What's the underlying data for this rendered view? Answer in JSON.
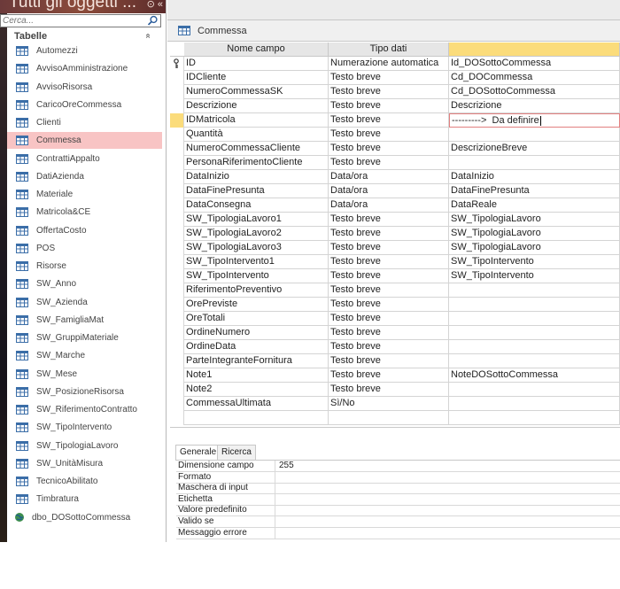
{
  "nav": {
    "title": "Tutti gli oggetti ...",
    "header_icons": "⊙ «",
    "search_placeholder": "Cerca...",
    "group_label": "Tabelle",
    "group_chevron": "«",
    "items": [
      {
        "label": "Automezzi",
        "type": "table",
        "selected": false
      },
      {
        "label": "AvvisoAmministrazione",
        "type": "table",
        "selected": false
      },
      {
        "label": "AvvisoRisorsa",
        "type": "table",
        "selected": false
      },
      {
        "label": "CaricoOreCommessa",
        "type": "table",
        "selected": false
      },
      {
        "label": "Clienti",
        "type": "table",
        "selected": false
      },
      {
        "label": "Commessa",
        "type": "table",
        "selected": true
      },
      {
        "label": "ContrattiAppalto",
        "type": "table",
        "selected": false
      },
      {
        "label": "DatiAzienda",
        "type": "table",
        "selected": false
      },
      {
        "label": "Materiale",
        "type": "table",
        "selected": false
      },
      {
        "label": "Matricola&CE",
        "type": "table",
        "selected": false
      },
      {
        "label": "OffertaCosto",
        "type": "table",
        "selected": false
      },
      {
        "label": "POS",
        "type": "table",
        "selected": false
      },
      {
        "label": "Risorse",
        "type": "table",
        "selected": false
      },
      {
        "label": "SW_Anno",
        "type": "table",
        "selected": false
      },
      {
        "label": "SW_Azienda",
        "type": "table",
        "selected": false
      },
      {
        "label": "SW_FamigliaMat",
        "type": "table",
        "selected": false
      },
      {
        "label": "SW_GruppiMateriale",
        "type": "table",
        "selected": false
      },
      {
        "label": "SW_Marche",
        "type": "table",
        "selected": false
      },
      {
        "label": "SW_Mese",
        "type": "table",
        "selected": false
      },
      {
        "label": "SW_PosizioneRisorsa",
        "type": "table",
        "selected": false
      },
      {
        "label": "SW_RiferimentoContratto",
        "type": "table",
        "selected": false
      },
      {
        "label": "SW_TipoIntervento",
        "type": "table",
        "selected": false
      },
      {
        "label": "SW_TipologiaLavoro",
        "type": "table",
        "selected": false
      },
      {
        "label": "SW_UnitàMisura",
        "type": "table",
        "selected": false
      },
      {
        "label": "TecnicoAbilitato",
        "type": "table",
        "selected": false
      },
      {
        "label": "Timbratura",
        "type": "table",
        "selected": false
      },
      {
        "label": "dbo_DOSottoCommessa",
        "type": "linked",
        "selected": false
      }
    ]
  },
  "document": {
    "tab_title": "Commessa",
    "columns": [
      "Nome campo",
      "Tipo dati",
      ""
    ],
    "rows": [
      {
        "name": "ID",
        "type": "Numerazione automatica",
        "desc": "Id_DOSottoCommessa",
        "key": true
      },
      {
        "name": "IDCliente",
        "type": "Testo breve",
        "desc": "Cd_DOCommessa"
      },
      {
        "name": "NumeroCommessaSK",
        "type": "Testo breve",
        "desc": "Cd_DOSottoCommessa"
      },
      {
        "name": "Descrizione",
        "type": "Testo breve",
        "desc": "Descrizione"
      },
      {
        "name": "IDMatricola",
        "type": "Testo breve",
        "desc": "--------->  Da definire",
        "active": true
      },
      {
        "name": "Quantità",
        "type": "Testo breve",
        "desc": ""
      },
      {
        "name": "NumeroCommessaCliente",
        "type": "Testo breve",
        "desc": "DescrizioneBreve"
      },
      {
        "name": "PersonaRiferimentoCliente",
        "type": "Testo breve",
        "desc": ""
      },
      {
        "name": "DataInizio",
        "type": "Data/ora",
        "desc": "DataInizio"
      },
      {
        "name": "DataFinePresunta",
        "type": "Data/ora",
        "desc": "DataFinePresunta"
      },
      {
        "name": "DataConsegna",
        "type": "Data/ora",
        "desc": "DataReale"
      },
      {
        "name": "SW_TipologiaLavoro1",
        "type": "Testo breve",
        "desc": "SW_TipologiaLavoro"
      },
      {
        "name": "SW_TipologiaLavoro2",
        "type": "Testo breve",
        "desc": "SW_TipologiaLavoro"
      },
      {
        "name": "SW_TipologiaLavoro3",
        "type": "Testo breve",
        "desc": "SW_TipologiaLavoro"
      },
      {
        "name": "SW_TipoIntervento1",
        "type": "Testo breve",
        "desc": "SW_TipoIntervento"
      },
      {
        "name": "SW_TipoIntervento",
        "type": "Testo breve",
        "desc": "SW_TipoIntervento"
      },
      {
        "name": "RiferimentoPreventivo",
        "type": "Testo breve",
        "desc": ""
      },
      {
        "name": "OrePreviste",
        "type": "Testo breve",
        "desc": ""
      },
      {
        "name": "OreTotali",
        "type": "Testo breve",
        "desc": ""
      },
      {
        "name": "OrdineNumero",
        "type": "Testo breve",
        "desc": ""
      },
      {
        "name": "OrdineData",
        "type": "Testo breve",
        "desc": ""
      },
      {
        "name": "ParteIntegranteFornitura",
        "type": "Testo breve",
        "desc": ""
      },
      {
        "name": "Note1",
        "type": "Testo breve",
        "desc": "NoteDOSottoCommessa"
      },
      {
        "name": "Note2",
        "type": "Testo breve",
        "desc": ""
      },
      {
        "name": "CommessaUltimata",
        "type": "Sì/No",
        "desc": ""
      },
      {
        "name": "",
        "type": "",
        "desc": ""
      }
    ]
  },
  "properties": {
    "tabs": [
      "Generale",
      "Ricerca"
    ],
    "active_tab": "Generale",
    "rows": [
      {
        "label": "Dimensione campo",
        "value": "255"
      },
      {
        "label": "Formato",
        "value": ""
      },
      {
        "label": "Maschera di input",
        "value": ""
      },
      {
        "label": "Etichetta",
        "value": ""
      },
      {
        "label": "Valore predefinito",
        "value": ""
      },
      {
        "label": "Valido se",
        "value": ""
      },
      {
        "label": "Messaggio errore",
        "value": ""
      }
    ]
  },
  "colors": {
    "selected_nav": "#f8c4c4",
    "header_highlight": "#fbdc7b",
    "edit_border": "#e28080",
    "table_icon": "#3b6ea8"
  }
}
